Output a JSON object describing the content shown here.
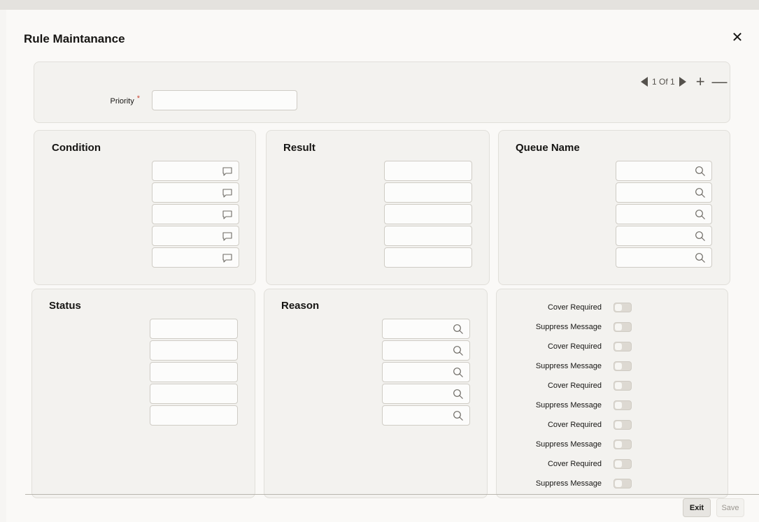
{
  "window": {
    "title": "Rule Maintanance",
    "close_icon": "close-icon"
  },
  "header": {
    "priority_label": "Priority",
    "required_mark": "*",
    "priority_value": "",
    "pager_text": "1 Of 1",
    "add_symbol": "+",
    "remove_symbol": "—"
  },
  "sections": {
    "condition": "Condition",
    "result": "Result",
    "queue_name": "Queue Name",
    "status": "Status",
    "reason": "Reason"
  },
  "toggles": [
    {
      "label": "Cover Required",
      "on": false
    },
    {
      "label": "Suppress Message",
      "on": false
    },
    {
      "label": "Cover Required",
      "on": false
    },
    {
      "label": "Suppress Message",
      "on": false
    },
    {
      "label": "Cover Required",
      "on": false
    },
    {
      "label": "Suppress Message",
      "on": false
    },
    {
      "label": "Cover Required",
      "on": false
    },
    {
      "label": "Suppress Message",
      "on": false
    },
    {
      "label": "Cover Required",
      "on": false
    },
    {
      "label": "Suppress Message",
      "on": false
    }
  ],
  "footer": {
    "exit_label": "Exit",
    "save_label": "Save"
  },
  "colors": {
    "accent_required": "#c74634",
    "panel_bg": "#f3f2ef",
    "field_border": "#cfccc5"
  }
}
